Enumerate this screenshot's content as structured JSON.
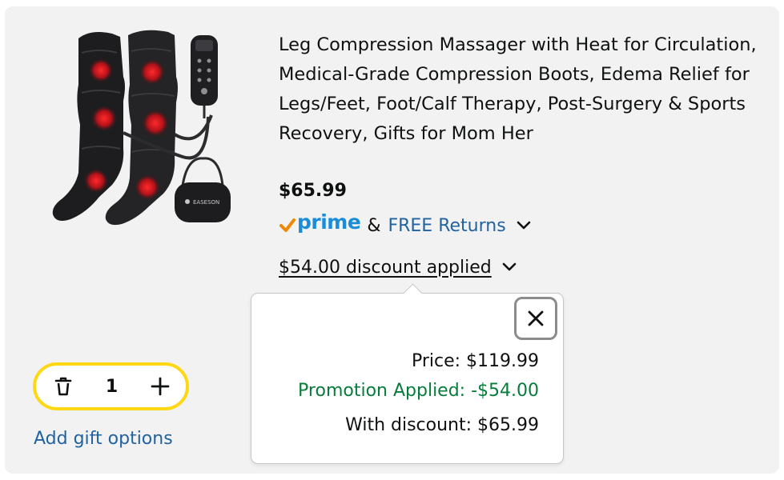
{
  "cart_item": {
    "title": "Leg Compression Massager with Heat for Circulation, Medical-Grade Compression Boots, Edema Relief for Legs/Feet, Foot/Calf Therapy, Post-Surgery & Sports Recovery, Gifts for Mom Her",
    "price": "$65.99",
    "image_icon": "leg-compression-boots-product-photo",
    "bag_brand_text": "EASESON",
    "delivery": {
      "prime_label": "prime",
      "ampersand": "&",
      "returns_label": "FREE Returns"
    },
    "discount_label": "$54.00 discount applied",
    "quantity": "1",
    "gift_options_label": "Add gift options"
  },
  "discount_popover": {
    "price_line": "Price: $119.99",
    "promotion_line": "Promotion Applied: -$54.00",
    "with_discount_line": "With discount: $65.99"
  },
  "colors": {
    "link_blue": "#2162a1",
    "prime_blue": "#1a8cd8",
    "prime_check_orange": "#f08804",
    "promo_green": "#067d3a",
    "quantity_border_yellow": "#ffd814",
    "card_background": "#f2f2f2"
  }
}
